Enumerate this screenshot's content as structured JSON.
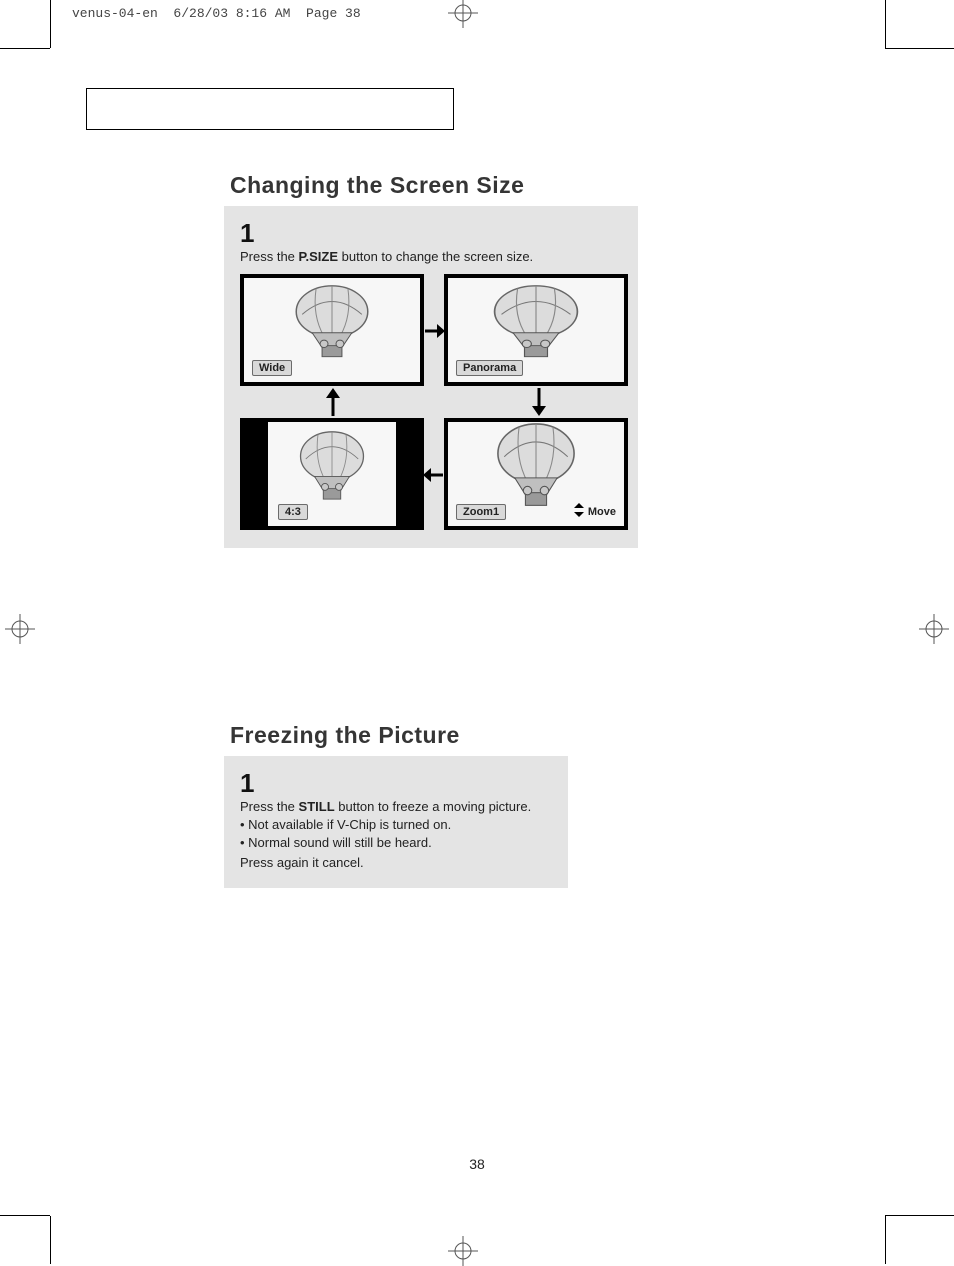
{
  "slug": "venus-04-en  6/28/03 8:16 AM  Page 38",
  "headings": {
    "changing_screen_size": "Changing the Screen Size",
    "freezing_picture": "Freezing the Picture"
  },
  "size_panel": {
    "step_num": "1",
    "text_pre": "Press the ",
    "text_bold": "P.SIZE",
    "text_post": " button to change the screen size.",
    "labels": {
      "wide": "Wide",
      "panorama": "Panorama",
      "zoom1": "Zoom1",
      "fourthree": "4:3",
      "move": "Move"
    }
  },
  "freeze_panel": {
    "step_num": "1",
    "line1_pre": "Press the ",
    "line1_bold": "STILL",
    "line1_post": " button to freeze a moving picture.",
    "bullet1": "• Not available if V-Chip is turned on.",
    "bullet2": "• Normal sound will still be heard.",
    "line_last": "Press again it cancel."
  },
  "page_number": "38"
}
